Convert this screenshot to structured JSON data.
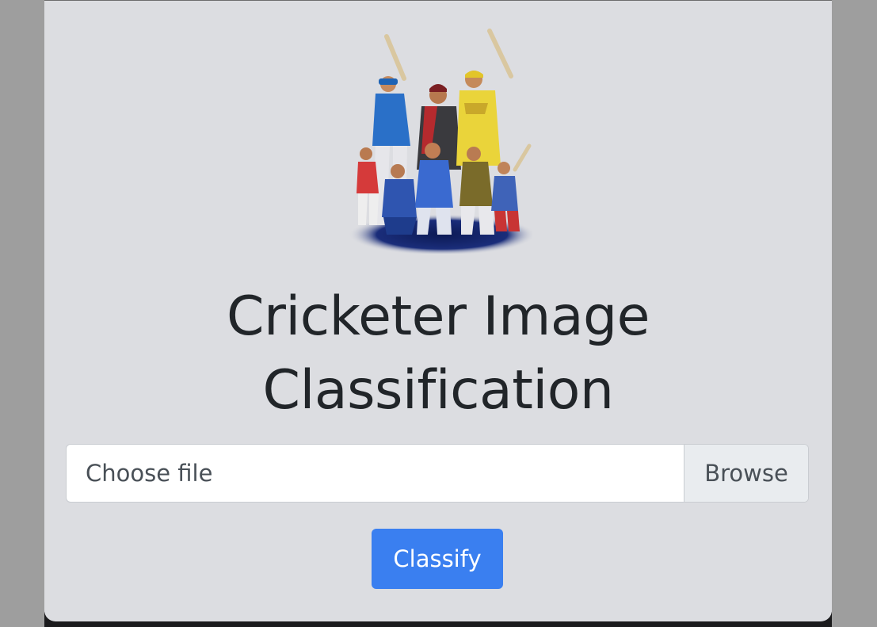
{
  "title": {
    "line1": "Cricketer Image",
    "line2": "Classification"
  },
  "hero_image": {
    "icon": "cricketers-illustration"
  },
  "file_input": {
    "label": "Choose file",
    "browse_label": "Browse"
  },
  "classify_button": {
    "label": "Classify"
  },
  "colors": {
    "card_background": "#dcdde1",
    "outer_background": "#9e9e9e",
    "primary": "#3a7ff0",
    "title_text": "#212529"
  }
}
